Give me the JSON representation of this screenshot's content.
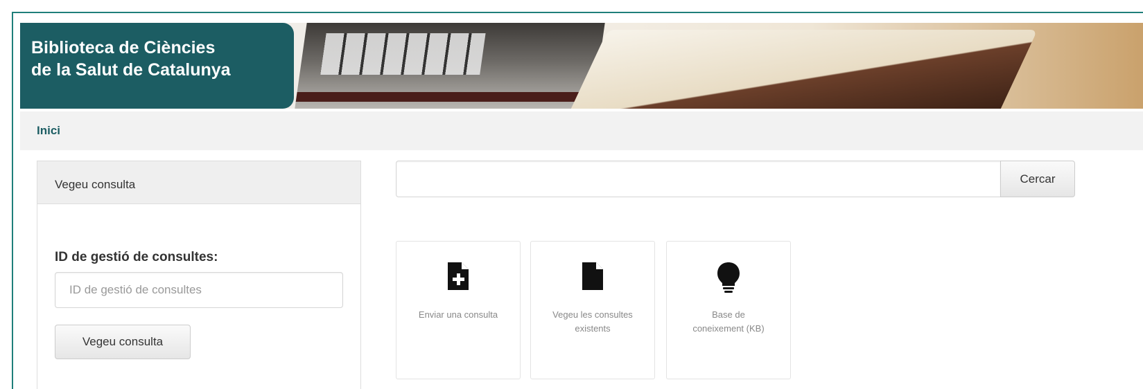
{
  "header": {
    "site_title": "Biblioteca de Ciències\nde la Salut de Catalunya"
  },
  "nav": {
    "home": "Inici"
  },
  "sidebar_panel": {
    "title": "Vegeu consulta",
    "id_label": "ID de gestió de consultes:",
    "id_placeholder": "ID de gestió de consultes",
    "id_value": "",
    "button_label": "Vegeu consulta"
  },
  "search": {
    "value": "",
    "button_label": "Cercar"
  },
  "tiles": [
    {
      "label": "Enviar una consulta",
      "icon": "file-plus-icon"
    },
    {
      "label": "Vegeu les consultes\nexistents",
      "icon": "file-icon"
    },
    {
      "label": "Base de\nconeixement (KB)",
      "icon": "lightbulb-icon"
    }
  ],
  "colors": {
    "brand": "#1c5d63",
    "frame_border": "#1f7f7a"
  }
}
